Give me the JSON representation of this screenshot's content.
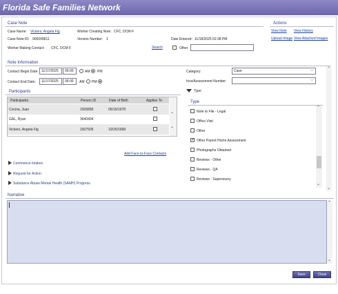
{
  "window": {
    "title": "Florida Safe Families Network"
  },
  "case_note": {
    "section_title": "Case Note",
    "case_name_label": "Case Name:",
    "case_name": "Vickers, Angela Fig",
    "case_note_id_label": "Case Note ID:",
    "case_note_id": "900049811",
    "worker_creating_label": "Worker Creating Note:",
    "worker_creating": "CFC, DCM-F",
    "version_label": "Version Number:",
    "version": "1",
    "date_entered_label": "Date Entered:",
    "date_entered": "11/18/2025 02:38 PM",
    "worker_making_label": "Worker Making Contact:",
    "worker_making": "CFC, DCM-F",
    "search_link": "Search",
    "other_label": "Other"
  },
  "actions": {
    "title": "Actions",
    "view_note": "View Note",
    "view_history": "View History",
    "upload_image": "Upload Image",
    "view_attached_images": "View Attached Images"
  },
  "note_info": {
    "title": "Note Information",
    "begin_label": "Contact Begin Date:",
    "begin_date": "11/17/2025",
    "begin_time": "05:00",
    "end_label": "Contact End Date:",
    "end_date": "11/17/2025",
    "end_time": "06:00",
    "am": "AM",
    "pm": "PM",
    "category_label": "Category:",
    "category_value": "Case",
    "invs_label": "Invs/Assessment Number:",
    "invs_value": "",
    "type_toggle": "Type"
  },
  "participants": {
    "title": "Participants",
    "columns": [
      "Participants",
      "Person ID",
      "Date of Birth",
      "Applies To"
    ],
    "rows": [
      {
        "name": "Cocina, Juan",
        "id": "1505895",
        "dob": "05/16/1978",
        "applies": false
      },
      {
        "name": "GAL, Ryan",
        "id": "3640404",
        "dob": "",
        "applies": false
      },
      {
        "name": "Vickers, Angela Fig",
        "id": "1507505",
        "dob": "10/25/1968",
        "applies": false
      }
    ],
    "add_link": "Add Face-to-Face Contacts"
  },
  "expanders": [
    "Commence Intakes",
    "Request for Action",
    "Substance Abuse Mental Health (SAMH) Progress"
  ],
  "type_list": {
    "title": "Type",
    "items": [
      {
        "label": "Note to File - Legal",
        "checked": false
      },
      {
        "label": "Office Visit",
        "checked": false
      },
      {
        "label": "Other",
        "checked": false
      },
      {
        "label": "Other Parent Home Assessment",
        "checked": true
      },
      {
        "label": "Photographs Obtained",
        "checked": false
      },
      {
        "label": "Reviews - Other",
        "checked": false
      },
      {
        "label": "Reviews - QA",
        "checked": false
      },
      {
        "label": "Reviews - Supervisory",
        "checked": false
      }
    ]
  },
  "narrative": {
    "title": "Narrative",
    "text": ""
  },
  "footer": {
    "save": "Save",
    "close": "Close"
  }
}
